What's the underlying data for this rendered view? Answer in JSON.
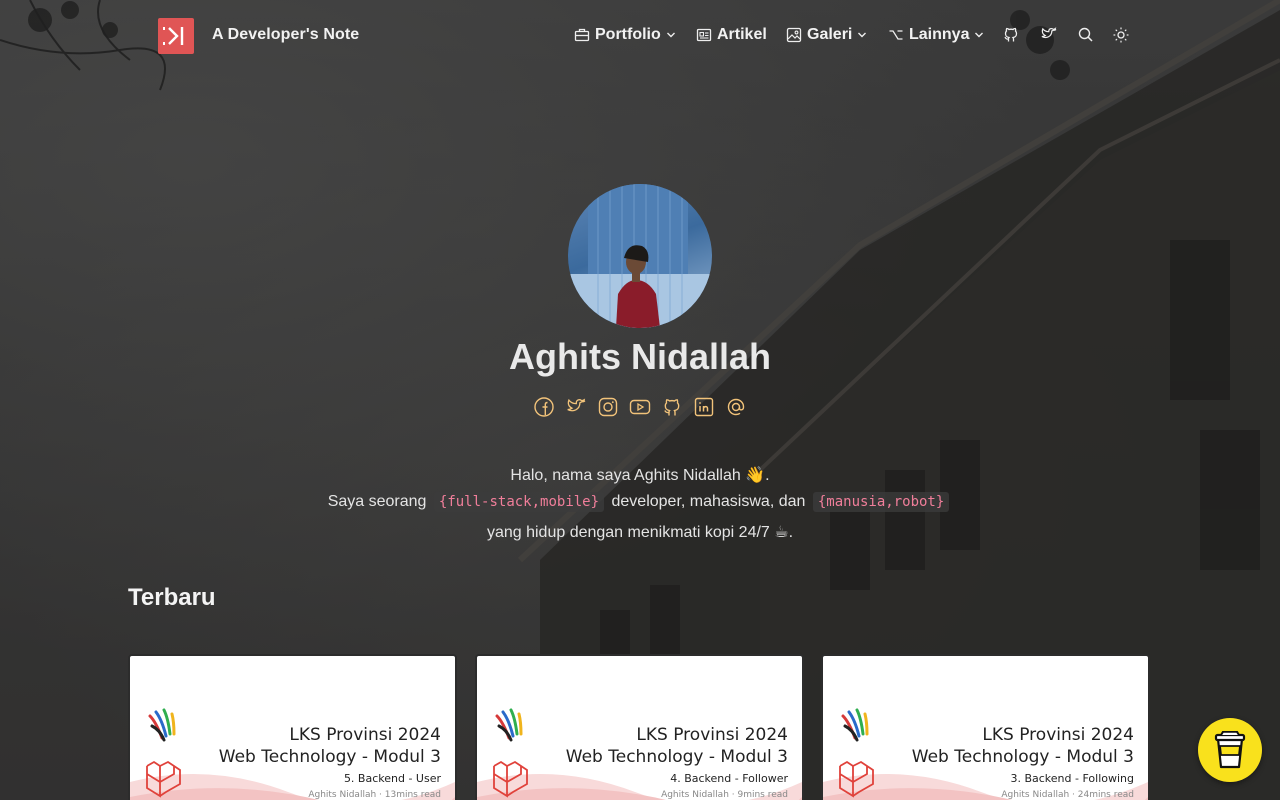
{
  "header": {
    "site_title": "A Developer's Note",
    "nav": [
      {
        "label": "Portfolio",
        "icon": "briefcase-icon",
        "dropdown": true
      },
      {
        "label": "Artikel",
        "icon": "article-icon",
        "dropdown": false
      },
      {
        "label": "Galeri",
        "icon": "image-icon",
        "dropdown": true
      },
      {
        "label": "Lainnya",
        "icon": "option-key-icon",
        "dropdown": true
      }
    ],
    "icon_buttons": [
      "github-icon",
      "twitter-icon",
      "search-icon",
      "theme-toggle-sun-icon"
    ]
  },
  "hero": {
    "name": "Aghits Nidallah",
    "socials": [
      "facebook-icon",
      "twitter-icon",
      "instagram-icon",
      "youtube-icon",
      "github-icon",
      "linkedin-icon",
      "email-at-icon"
    ],
    "intro_line1": "Halo, nama saya Aghits Nidallah 👋.",
    "intro_line2_a": "Saya seorang",
    "intro_line2_code1": "{full-stack,mobile}",
    "intro_line2_b": "developer, mahasiswa, dan",
    "intro_line2_code2": "{manusia,robot}",
    "intro_line3": "yang hidup dengan menikmati kopi 24/7 ☕."
  },
  "latest": {
    "title": "Terbaru",
    "cards": [
      {
        "title_line1": "LKS Provinsi 2024",
        "title_line2": "Web Technology - Modul 3",
        "subtitle": "5. Backend - User",
        "meta": "Aghits Nidallah · 13mins read"
      },
      {
        "title_line1": "LKS Provinsi 2024",
        "title_line2": "Web Technology - Modul 3",
        "subtitle": "4. Backend - Follower",
        "meta": "Aghits Nidallah · 9mins read"
      },
      {
        "title_line1": "LKS Provinsi 2024",
        "title_line2": "Web Technology - Modul 3",
        "subtitle": "3. Backend - Following",
        "meta": "Aghits Nidallah · 24mins read"
      }
    ]
  },
  "colors": {
    "logo_red": "#e05555",
    "code_pink": "#f07e9a",
    "social_icon_orange": "#f2c37a",
    "coffee_yellow": "#f9e11c"
  },
  "floating_button": {
    "icon": "buy-me-a-coffee-icon"
  }
}
